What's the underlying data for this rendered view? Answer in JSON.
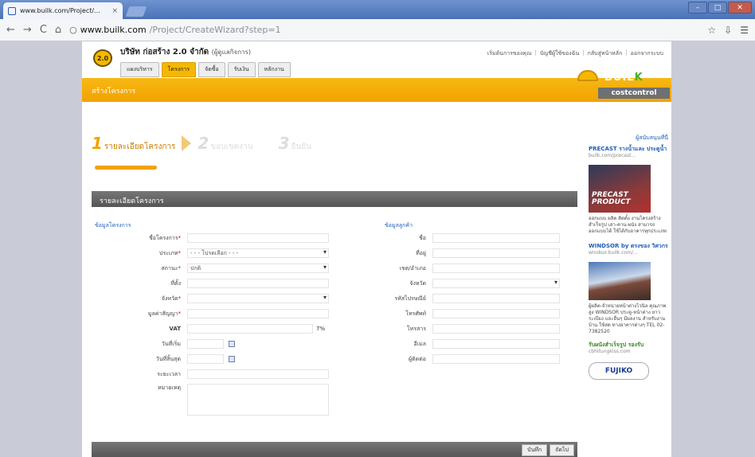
{
  "browser": {
    "tab_title": "www.builk.com/Project/...",
    "tab_close": "×",
    "url_host": "www.builk.com",
    "url_path": "/Project/CreateWizard?step=1",
    "nav_back": "←",
    "nav_forward": "→",
    "nav_reload": "C",
    "nav_home": "⌂",
    "tool_icons": [
      "☆",
      "⇩",
      "☰"
    ]
  },
  "site": {
    "logo_text": "2.0",
    "company": "บริษัท ก่อสร้าง 2.0 จำกัด",
    "company_note": "(ผู้ดูแลกิจการ)",
    "menu": [
      "แผงบริหาร",
      "โครงการ",
      "จัดซื้อ",
      "รับเงิน",
      "หลักงาน"
    ],
    "top_links": [
      "เริ่มต้นการของคุณ",
      "บัญชีผู้ใช้ของฉัน",
      "กลับสู่หน้าหลัก",
      "ออกจากระบบ"
    ],
    "page_title": "สร้างโครงการ",
    "brand_word": "BUIL",
    "brand_k": "K",
    "brand_sub": "costcontrol"
  },
  "wizard": {
    "steps": [
      {
        "num": "1",
        "label": "รายละเอียดโครงการ"
      },
      {
        "num": "2",
        "label": "ขอบเขตงาน"
      },
      {
        "num": "3",
        "label": "ยืนยัน"
      }
    ]
  },
  "form": {
    "section_title": "รายละเอียดโครงการ",
    "project_group": "ข้อมูลโครงการ",
    "customer_group": "ข้อมูลลูกค้า",
    "fields_left": [
      {
        "label": "ชื่อโครงการ",
        "required": "*",
        "value": ""
      },
      {
        "label": "ประเภท",
        "required": "*",
        "value": "- - - โปรดเลือก - - -"
      },
      {
        "label": "สถานะ",
        "required": "*",
        "value": "ปกติ"
      },
      {
        "label": "ที่ตั้ง",
        "required": "",
        "value": ""
      },
      {
        "label": "จังหวัด",
        "required": "*",
        "value": ""
      },
      {
        "label": "มูลค่าสัญญา",
        "required": "*",
        "value": ""
      },
      {
        "label": "VAT",
        "required": "",
        "value": "7%"
      },
      {
        "label": "วันที่เริ่ม",
        "required": "",
        "value": ""
      },
      {
        "label": "วันที่สิ้นสุด",
        "required": "",
        "value": ""
      },
      {
        "label": "ระยะเวลา",
        "required": "",
        "value": ""
      },
      {
        "label": "หมายเหตุ",
        "required": "",
        "value": ""
      }
    ],
    "fields_right": [
      {
        "label": "ชื่อ",
        "value": ""
      },
      {
        "label": "ที่อยู่",
        "value": ""
      },
      {
        "label": "เขต/อำเภอ",
        "value": ""
      },
      {
        "label": "จังหวัด",
        "value": ""
      },
      {
        "label": "รหัสไปรษณีย์",
        "value": ""
      },
      {
        "label": "โทรศัพท์",
        "value": ""
      },
      {
        "label": "โทรสาร",
        "value": ""
      },
      {
        "label": "อีเมล",
        "value": ""
      },
      {
        "label": "ผู้ติดต่อ",
        "value": ""
      }
    ],
    "bottom_buttons": [
      "บันทึก",
      "ถัดไป"
    ]
  },
  "sidebar": {
    "header": "ผู้สนับสนุนที่นี่",
    "ads": [
      {
        "title": "PRECAST รางน้ำและ ประตูน้ำ",
        "sub": "builk.com/precast...",
        "img_text": "PRECAST PRODUCT",
        "desc": "ออกแบบ ผลิต ติดตั้ง งานโครงสร้างสำเร็จรูป เสา-คาน-ผนัง สามารถออกแบบได้ ใช้ได้กับอาคารทุกประเภท"
      },
      {
        "title": "WINDSOR by ตรงของ วิศวกร",
        "sub": "windsor.builk.com/...",
        "img_text": "",
        "desc": "ผู้ผลิต-จำหน่ายหน้าต่างไวนิล คุณภาพสูง WINDSOR ประตู-หน้าต่าง ยาวระเบียง และอื่นๆ มีผลงาน สำหรับงานบ้าน ใช้สด ทางอาคารต่างๆ TEL 02-7382520"
      },
      {
        "title": "รับผนังสำเร็จรูป รองรับ",
        "sub": "cbhitungkiss.com",
        "img_text": "",
        "desc": ""
      }
    ],
    "bottom_logo": "FUJIKO"
  }
}
